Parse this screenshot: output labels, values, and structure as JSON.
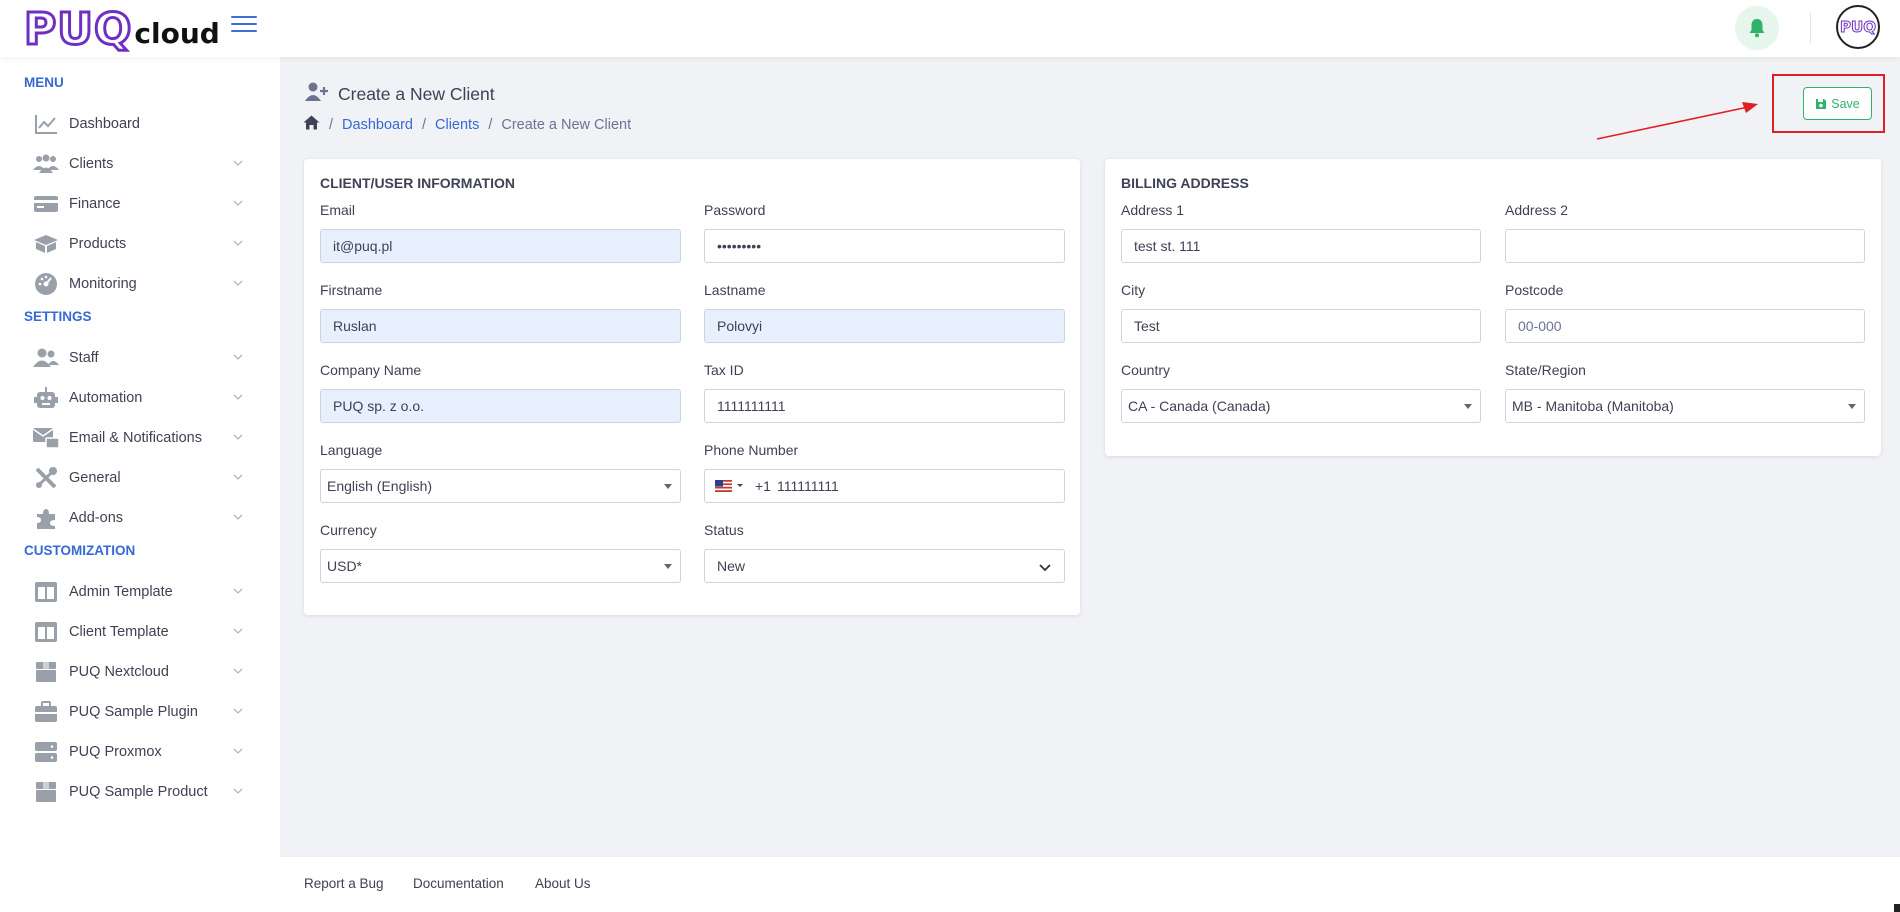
{
  "app": {
    "logo_main": "PUQ",
    "logo_sub": "cloud",
    "avatar_text": "PUQ"
  },
  "sidebar": {
    "sections": [
      {
        "title": "MENU",
        "items": [
          {
            "label": "Dashboard",
            "icon": "dashboard-chart-icon",
            "chevron": false
          },
          {
            "label": "Clients",
            "icon": "users-icon",
            "chevron": true
          },
          {
            "label": "Finance",
            "icon": "credit-card-icon",
            "chevron": true
          },
          {
            "label": "Products",
            "icon": "box-icon",
            "chevron": true
          },
          {
            "label": "Monitoring",
            "icon": "gauge-icon",
            "chevron": true
          }
        ]
      },
      {
        "title": "SETTINGS",
        "items": [
          {
            "label": "Staff",
            "icon": "staff-icon",
            "chevron": true
          },
          {
            "label": "Automation",
            "icon": "robot-icon",
            "chevron": true
          },
          {
            "label": "Email & Notifications",
            "icon": "mail-bell-icon",
            "chevron": true
          },
          {
            "label": "General",
            "icon": "tools-icon",
            "chevron": true
          },
          {
            "label": "Add-ons",
            "icon": "puzzle-icon",
            "chevron": true
          }
        ]
      },
      {
        "title": "CUSTOMIZATION",
        "items": [
          {
            "label": "Admin Template",
            "icon": "layout-icon",
            "chevron": true
          },
          {
            "label": "Client Template",
            "icon": "layout-icon",
            "chevron": true
          },
          {
            "label": "PUQ Nextcloud",
            "icon": "box-icon",
            "chevron": true
          },
          {
            "label": "PUQ Sample Plugin",
            "icon": "briefcase-icon",
            "chevron": true
          },
          {
            "label": "PUQ Proxmox",
            "icon": "server-icon",
            "chevron": true
          },
          {
            "label": "PUQ Sample Product",
            "icon": "box-icon",
            "chevron": true
          }
        ]
      }
    ]
  },
  "header": {
    "title": "Create a New Client",
    "breadcrumb": [
      "Dashboard",
      "Clients",
      "Create a New Client"
    ],
    "save_label": "Save"
  },
  "client_info": {
    "title": "CLIENT/USER INFORMATION",
    "email_label": "Email",
    "email_value": "it@puq.pl",
    "password_label": "Password",
    "password_value": "•••••••••",
    "firstname_label": "Firstname",
    "firstname_value": "Ruslan",
    "lastname_label": "Lastname",
    "lastname_value": "Polovyi",
    "company_label": "Company Name",
    "company_value": "PUQ sp. z o.o.",
    "taxid_label": "Tax ID",
    "taxid_value": "1111111111",
    "language_label": "Language",
    "language_value": "English (English)",
    "phone_label": "Phone Number",
    "phone_code": "+1",
    "phone_value": "111111111",
    "currency_label": "Currency",
    "currency_value": "USD*",
    "status_label": "Status",
    "status_value": "New"
  },
  "billing": {
    "title": "BILLING ADDRESS",
    "address1_label": "Address 1",
    "address1_value": "test st. 111",
    "address2_label": "Address 2",
    "address2_value": "",
    "city_label": "City",
    "city_value": "Test",
    "postcode_label": "Postcode",
    "postcode_placeholder": "00-000",
    "country_label": "Country",
    "country_value": "CA - Canada (Canada)",
    "state_label": "State/Region",
    "state_value": "MB - Manitoba (Manitoba)"
  },
  "footer": {
    "links": [
      "Report a Bug",
      "Documentation",
      "About Us"
    ]
  },
  "colors": {
    "accent": "#3569d6",
    "brand": "#6f2fc1",
    "success": "#2fb36b",
    "annotation": "#e02020"
  }
}
